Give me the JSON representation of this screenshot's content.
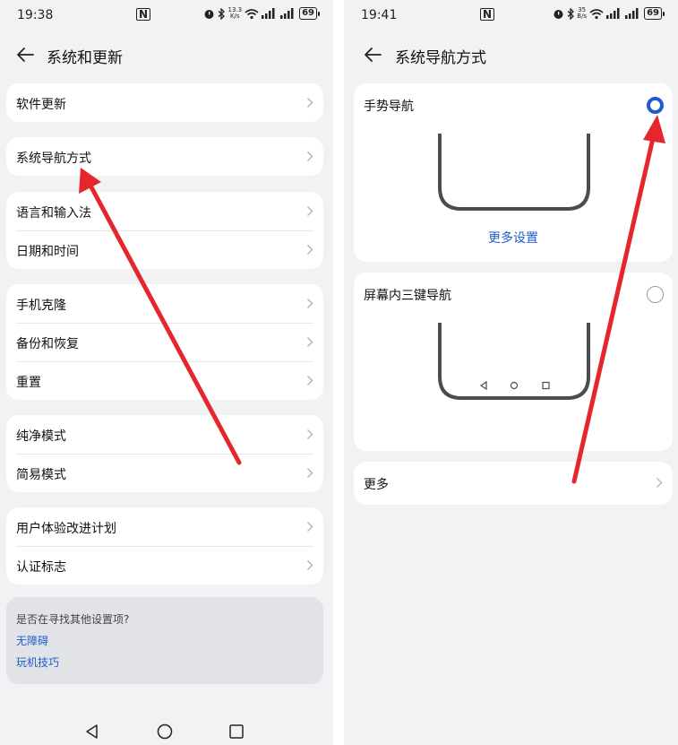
{
  "left": {
    "status": {
      "time": "19:38",
      "speed_top": "13.3",
      "speed_bottom": "K/s",
      "battery": "69"
    },
    "header": {
      "title": "系统和更新"
    },
    "groups": [
      [
        "软件更新"
      ],
      [
        "系统导航方式"
      ],
      [
        "语言和输入法",
        "日期和时间"
      ],
      [
        "手机克隆",
        "备份和恢复",
        "重置"
      ],
      [
        "纯净模式",
        "简易模式"
      ],
      [
        "用户体验改进计划",
        "认证标志"
      ]
    ],
    "info": {
      "prompt": "是否在寻找其他设置项?",
      "links": [
        "无障碍",
        "玩机技巧"
      ]
    }
  },
  "right": {
    "status": {
      "time": "19:41",
      "speed_top": "35",
      "speed_bottom": "B/s",
      "battery": "69"
    },
    "header": {
      "title": "系统导航方式"
    },
    "gesture": {
      "label": "手势导航",
      "selected": true,
      "link": "更多设置"
    },
    "three_key": {
      "label": "屏幕内三键导航",
      "selected": false
    },
    "more": {
      "label": "更多"
    }
  },
  "colors": {
    "accent": "#1f5ccd",
    "annotation_arrow": "#e5262d",
    "background": "#f1f2f4"
  },
  "icons": [
    "back-arrow-icon",
    "chevron-right-icon",
    "nav-back-icon",
    "nav-home-icon",
    "nav-recent-icon",
    "nfc-icon",
    "alarm-icon",
    "bluetooth-icon",
    "wifi-icon",
    "signal-icon",
    "battery-icon"
  ]
}
